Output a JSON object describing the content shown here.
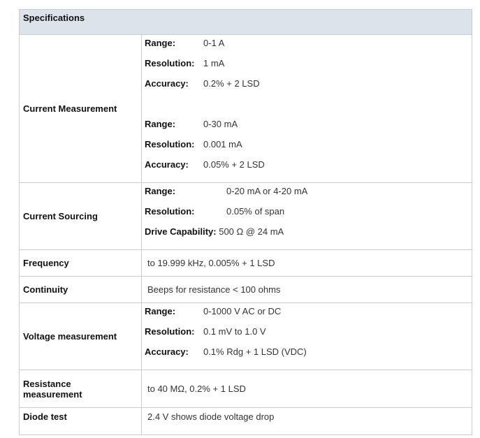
{
  "header": "Specifications",
  "rows": [
    {
      "label": "Current Measurement",
      "groups": [
        [
          {
            "k": "Range:",
            "v": "0-1 A"
          },
          {
            "k": "Resolution:",
            "v": "1 mA"
          },
          {
            "k": "Accuracy:",
            "v": "0.2% + 2 LSD"
          }
        ],
        [
          {
            "k": "Range:",
            "v": "0-30 mA"
          },
          {
            "k": "Resolution:",
            "v": "0.001 mA"
          },
          {
            "k": "Accuracy:",
            "v": "0.05% + 2 LSD"
          }
        ]
      ]
    },
    {
      "label": "Current Sourcing",
      "groups": [
        [
          {
            "k": "Range:",
            "v": "0-20 mA or 4-20 mA"
          },
          {
            "k": "Resolution:",
            "v": "0.05% of span"
          },
          {
            "k": "Drive Capability:",
            "v": "500 Ω @ 24 mA"
          }
        ]
      ]
    },
    {
      "label": "Frequency",
      "text": "to 19.999 kHz, 0.005% + 1 LSD"
    },
    {
      "label": "Continuity",
      "text": "Beeps for resistance < 100 ohms"
    },
    {
      "label": "Voltage measurement",
      "groups": [
        [
          {
            "k": "Range:",
            "v": "0-1000 V AC or DC"
          },
          {
            "k": "Resolution:",
            "v": "0.1 mV to 1.0 V"
          },
          {
            "k": "Accuracy:",
            "v": "0.1% Rdg + 1 LSD (VDC)"
          }
        ]
      ]
    },
    {
      "label": "Resistance measurement",
      "text": "to 40 MΩ, 0.2% + 1 LSD"
    },
    {
      "label": "Diode test",
      "text": "2.4 V shows diode voltage drop"
    }
  ]
}
